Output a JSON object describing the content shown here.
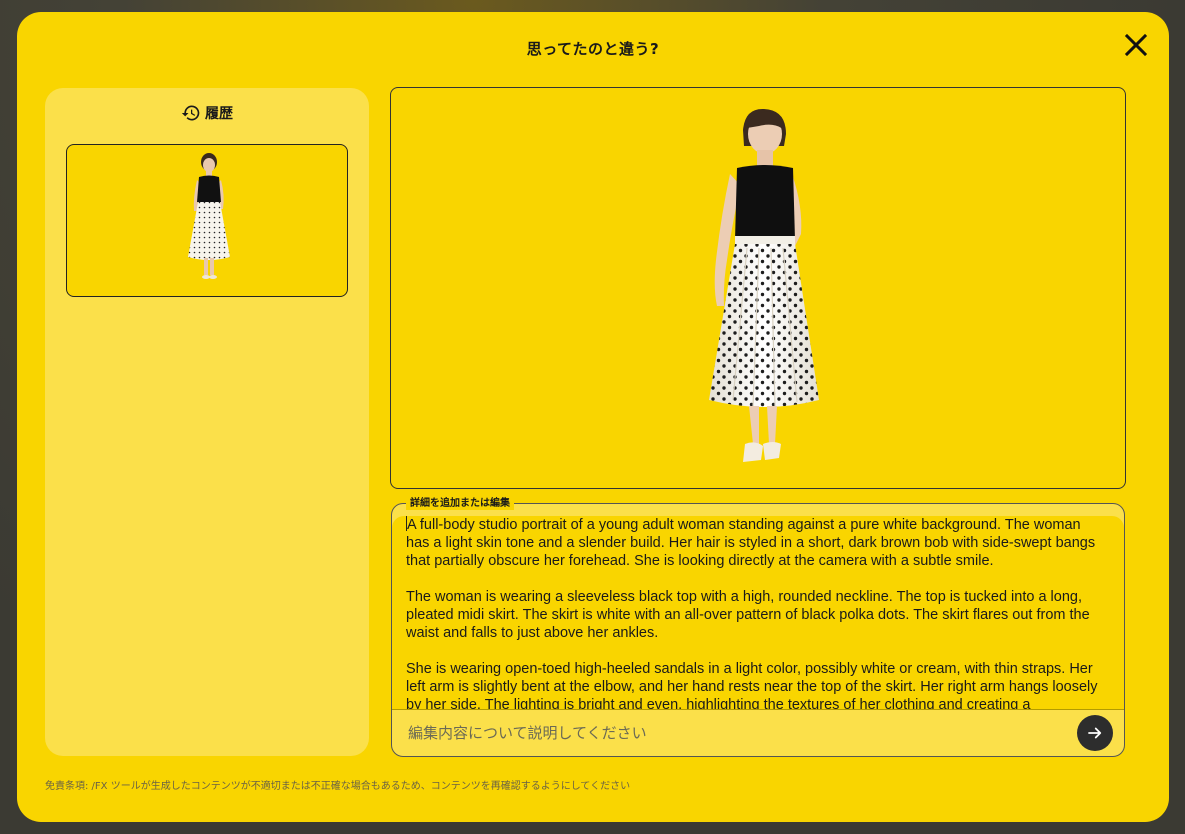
{
  "modal": {
    "title": "思ってたのと違う?",
    "close_icon": "close-icon"
  },
  "history": {
    "title": "履歴",
    "icon": "history-icon",
    "items": [
      {
        "alt": "woman in black top and polka dot skirt"
      }
    ]
  },
  "preview": {
    "alt": "woman in black sleeveless top and white polka dot pleated midi skirt"
  },
  "edit": {
    "legend": "詳細を追加または編集",
    "paragraphs": [
      "A full-body studio portrait of a young adult woman standing against a pure white background. The woman has a light skin tone and a slender build. Her hair is styled in a short, dark brown bob with side-swept bangs that partially obscure her forehead. She is looking directly at the camera with a subtle smile.",
      "The woman is wearing a sleeveless black top with a high, rounded neckline. The top is tucked into a long, pleated midi skirt. The skirt is white with an all-over pattern of black polka dots. The skirt flares out from the waist and falls to just above her ankles.",
      "She is wearing open-toed high-heeled sandals in a light color, possibly white or cream, with thin straps. Her left arm is slightly bent at the elbow, and her hand rests near the top of the skirt. Her right arm hangs loosely by her side. The lighting is bright and even, highlighting the textures of her clothing and creating a"
    ],
    "instruction_placeholder": "編集内容について説明してください",
    "submit_icon": "arrow-right-icon"
  },
  "disclaimer": "免責条項: /FX ツールが生成したコンテンツが不適切または不正確な場合もあるため、コンテンツを再確認するようにしてください",
  "colors": {
    "modal_bg": "#f9d500",
    "panel_bg": "#fbe04a",
    "submit_bg": "#2d2d2d"
  }
}
